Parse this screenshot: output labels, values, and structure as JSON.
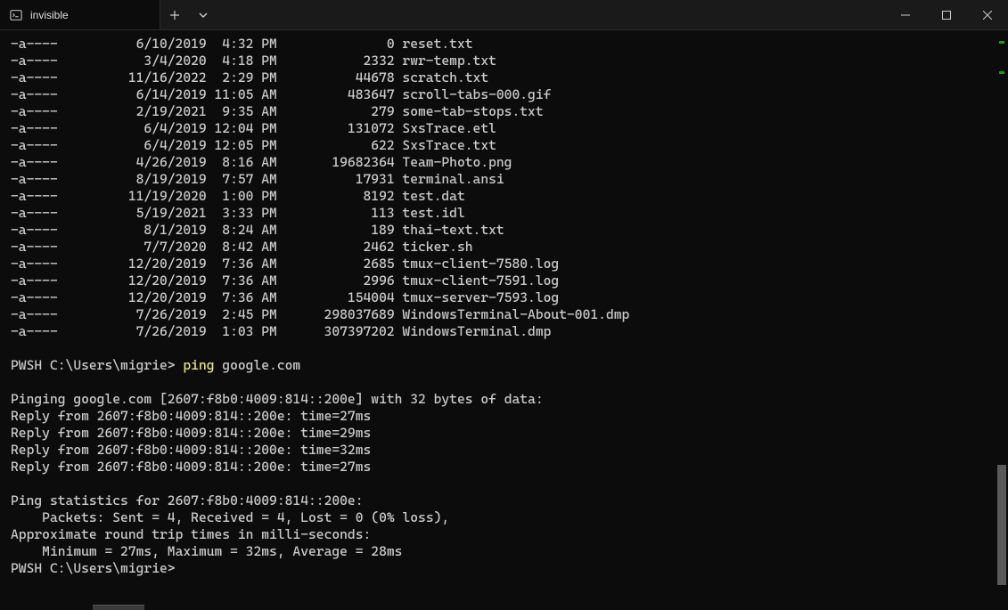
{
  "window": {
    "tab_title": "invisible",
    "new_tab_label": "+",
    "dropdown_label": "⌄"
  },
  "files": [
    {
      "mode": "-a----",
      "date": "6/10/2019",
      "time": "4:32 PM",
      "size": "0",
      "name": "reset.txt"
    },
    {
      "mode": "-a----",
      "date": "3/4/2020",
      "time": "4:18 PM",
      "size": "2332",
      "name": "rwr-temp.txt"
    },
    {
      "mode": "-a----",
      "date": "11/16/2022",
      "time": "2:29 PM",
      "size": "44678",
      "name": "scratch.txt"
    },
    {
      "mode": "-a----",
      "date": "6/14/2019",
      "time": "11:05 AM",
      "size": "483647",
      "name": "scroll-tabs-000.gif"
    },
    {
      "mode": "-a----",
      "date": "2/19/2021",
      "time": "9:35 AM",
      "size": "279",
      "name": "some-tab-stops.txt"
    },
    {
      "mode": "-a----",
      "date": "6/4/2019",
      "time": "12:04 PM",
      "size": "131072",
      "name": "SxsTrace.etl"
    },
    {
      "mode": "-a----",
      "date": "6/4/2019",
      "time": "12:05 PM",
      "size": "622",
      "name": "SxsTrace.txt"
    },
    {
      "mode": "-a----",
      "date": "4/26/2019",
      "time": "8:16 AM",
      "size": "19682364",
      "name": "Team-Photo.png"
    },
    {
      "mode": "-a----",
      "date": "8/19/2019",
      "time": "7:57 AM",
      "size": "17931",
      "name": "terminal.ansi"
    },
    {
      "mode": "-a----",
      "date": "11/19/2020",
      "time": "1:00 PM",
      "size": "8192",
      "name": "test.dat"
    },
    {
      "mode": "-a----",
      "date": "5/19/2021",
      "time": "3:33 PM",
      "size": "113",
      "name": "test.idl"
    },
    {
      "mode": "-a----",
      "date": "8/1/2019",
      "time": "8:24 AM",
      "size": "189",
      "name": "thai-text.txt"
    },
    {
      "mode": "-a----",
      "date": "7/7/2020",
      "time": "8:42 AM",
      "size": "2462",
      "name": "ticker.sh"
    },
    {
      "mode": "-a----",
      "date": "12/20/2019",
      "time": "7:36 AM",
      "size": "2685",
      "name": "tmux-client-7580.log"
    },
    {
      "mode": "-a----",
      "date": "12/20/2019",
      "time": "7:36 AM",
      "size": "2996",
      "name": "tmux-client-7591.log"
    },
    {
      "mode": "-a----",
      "date": "12/20/2019",
      "time": "7:36 AM",
      "size": "154004",
      "name": "tmux-server-7593.log"
    },
    {
      "mode": "-a----",
      "date": "7/26/2019",
      "time": "2:45 PM",
      "size": "298037689",
      "name": "WindowsTerminal-About-001.dmp"
    },
    {
      "mode": "-a----",
      "date": "7/26/2019",
      "time": "1:03 PM",
      "size": "307397202",
      "name": "WindowsTerminal.dmp"
    }
  ],
  "prompt1": {
    "prefix": "PWSH C:\\Users\\migrie> ",
    "cmd": "ping",
    "args": " google.com"
  },
  "ping": {
    "header": "Pinging google.com [2607:f8b0:4009:814::200e] with 32 bytes of data:",
    "replies": [
      "Reply from 2607:f8b0:4009:814::200e: time=27ms",
      "Reply from 2607:f8b0:4009:814::200e: time=29ms",
      "Reply from 2607:f8b0:4009:814::200e: time=32ms",
      "Reply from 2607:f8b0:4009:814::200e: time=27ms"
    ],
    "stats_header": "Ping statistics for 2607:f8b0:4009:814::200e:",
    "packets": "    Packets: Sent = 4, Received = 4, Lost = 0 (0% loss),",
    "rtt_header": "Approximate round trip times in milli-seconds:",
    "rtt_values": "    Minimum = 27ms, Maximum = 32ms, Average = 28ms"
  },
  "prompt2": {
    "text": "PWSH C:\\Users\\migrie>"
  }
}
